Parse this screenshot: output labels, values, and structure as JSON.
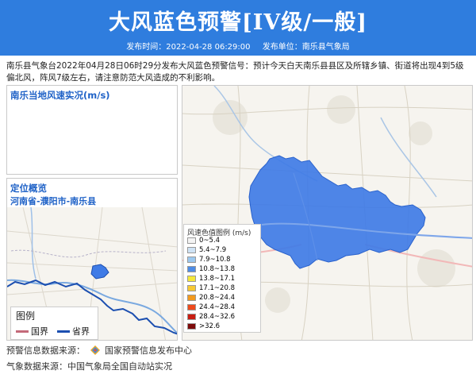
{
  "header": {
    "title": "大风蓝色预警[IV级/一般]",
    "publish_time": "发布时间：2022-04-28 06:29:00",
    "publish_unit": "发布单位：南乐县气象局"
  },
  "description": "南乐县气象台2022年04月28日06时29分发布大风蓝色预警信号：预计今天白天南乐县县区及所辖乡镇、街道将出现4到5级偏北风，阵风7级左右，请注意防范大风造成的不利影响。",
  "wind_panel": {
    "title": "南乐当地风速实况(m/s)"
  },
  "location_panel": {
    "title": "定位概览",
    "path": "河南省-濮阳市-南乐县"
  },
  "map_legend": {
    "title": "图例",
    "items": [
      {
        "label": "国界",
        "color": "#c46a7a"
      },
      {
        "label": "省界",
        "color": "#1c4fb0"
      }
    ]
  },
  "wind_legend": {
    "title": "风速色值图例 (m/s)",
    "items": [
      {
        "label": "0~5.4",
        "color": "#f4f4f4"
      },
      {
        "label": "5.4~7.9",
        "color": "#cfe3f5"
      },
      {
        "label": "7.9~10.8",
        "color": "#9cc8ef"
      },
      {
        "label": "10.8~13.8",
        "color": "#4d8ce6"
      },
      {
        "label": "13.8~17.1",
        "color": "#f5e83a"
      },
      {
        "label": "17.1~20.8",
        "color": "#f7c934"
      },
      {
        "label": "20.8~24.4",
        "color": "#f39a1e"
      },
      {
        "label": "24.4~28.4",
        "color": "#ee4a1c"
      },
      {
        "label": "28.4~32.6",
        "color": "#c81d12"
      },
      {
        "label": ">32.6",
        "color": "#7d0b0b"
      }
    ]
  },
  "footer": {
    "warning_source": "预警信息数据来源：",
    "warning_source_name": "国家预警信息发布中心",
    "weather_source": "气象数据来源：中国气象局全国自动站实况"
  },
  "colors": {
    "header_bg": "#2f7dde",
    "alert_area": "#3f7be6",
    "accent": "#1f62c7"
  }
}
